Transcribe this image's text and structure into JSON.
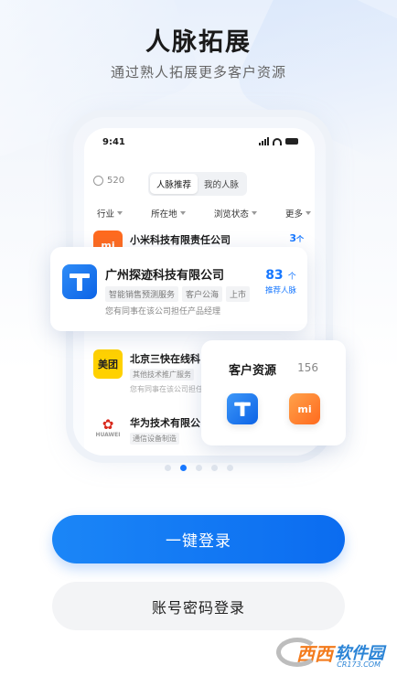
{
  "header": {
    "title": "人脉拓展",
    "subtitle": "通过熟人拓展更多客户资源"
  },
  "phone": {
    "time": "9:41",
    "coins": "520",
    "tabs": [
      {
        "label": "人脉推荐",
        "active": true
      },
      {
        "label": "我的人脉",
        "active": false
      }
    ],
    "filters": [
      "行业",
      "所在地",
      "浏览状态",
      "更多"
    ],
    "rows": [
      {
        "name": "小米科技有限责任公司",
        "logo_text": "mi",
        "count": "3",
        "unit": "个"
      },
      {
        "name": "北京三快在线科",
        "logo_text": "美团",
        "tags": [
          "其他技术推广服务"
        ],
        "note": "您有同事在该公司担任"
      },
      {
        "name": "华为技术有限公",
        "logo_text": "HUAWEI",
        "tags": [
          "通信设备制造"
        ]
      }
    ]
  },
  "featured_card": {
    "name": "广州探迹科技有限公司",
    "tags": [
      "智能销售预测服务",
      "客户公海",
      "上市"
    ],
    "note": "您有同事在该公司担任产品经理",
    "count": "83",
    "unit": "个",
    "count_label": "推荐人脉"
  },
  "resource_card": {
    "title": "客户资源",
    "count": "156",
    "logos": [
      "tanji-icon",
      "xiaomi-icon"
    ]
  },
  "pager": {
    "total": 5,
    "active": 1
  },
  "actions": {
    "one_click_login": "一键登录",
    "password_login": "账号密码登录"
  },
  "watermark": {
    "main": "西西",
    "sub": "软件园",
    "url": "CR173.COM"
  },
  "colors": {
    "accent": "#1677ff",
    "xiaomi": "#ff6a1e",
    "meituan": "#ffd100"
  }
}
